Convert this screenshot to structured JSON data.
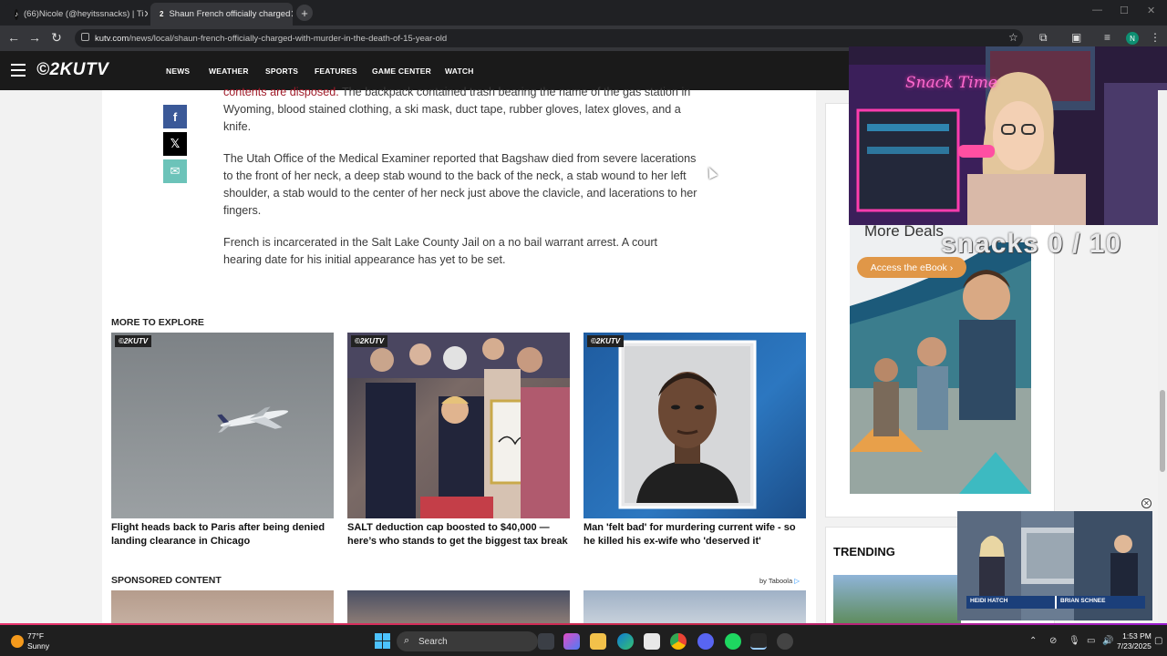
{
  "browser": {
    "tabs": [
      {
        "label": "(66)Nicole (@heyitssnacks) | Ti",
        "active": false
      },
      {
        "label": "Shaun French officially charged",
        "active": true
      }
    ],
    "url_domain": "kutv.com",
    "url_path": "/news/local/shaun-french-officially-charged-with-murder-in-the-death-of-15-year-old",
    "profile_initial": "N"
  },
  "site": {
    "logo": "©2KUTV",
    "nav": [
      "NEWS",
      "WEATHER",
      "SPORTS",
      "FEATURES",
      "GAME CENTER",
      "WATCH"
    ]
  },
  "article": {
    "p1_link": "contents are disposed.",
    "p1_text": " The backpack contained trash bearing the name of the gas station in Wyoming, blood stained clothing, a ski mask, duct tape, rubber gloves, latex gloves, and a knife.",
    "p2": "The Utah Office of the Medical Examiner reported that Bagshaw died from severe lacerations to the front of her neck, a deep stab wound to the back of the neck, a stab wound to her left shoulder, a stab would to the center of her neck just above the clavicle, and lacerations to her fingers.",
    "p3": "French is incarcerated in the Salt Lake County Jail on a no bail warrant arrest. A court hearing date for his initial appearance has yet to be set."
  },
  "explore": {
    "heading": "MORE TO EXPLORE",
    "badge": "©2KUTV",
    "cards": [
      {
        "title": "Flight heads back to Paris after being denied landing clearance in Chicago"
      },
      {
        "title": "SALT deduction cap boosted to $40,000 — here’s who stands to get the biggest tax break"
      },
      {
        "title": "Man 'felt bad' for murdering current wife - so he killed his ex-wife who 'deserved it'"
      }
    ]
  },
  "sponsored": {
    "heading": "SPONSORED CONTENT",
    "by": "by Taboola"
  },
  "sidebar": {
    "trending": "TRENDING",
    "ad_heading": "More Deals",
    "ad_button": "Access the eBook ›"
  },
  "overlay": {
    "neon": "Snack Time",
    "counter": "snacks 0 / 10",
    "video_names": [
      "HEIDI HATCH",
      "BRIAN SCHNEE"
    ]
  },
  "taskbar": {
    "temp": "77°F",
    "condition": "Sunny",
    "search": "Search",
    "time": "1:53 PM",
    "date": "7/23/2025"
  }
}
